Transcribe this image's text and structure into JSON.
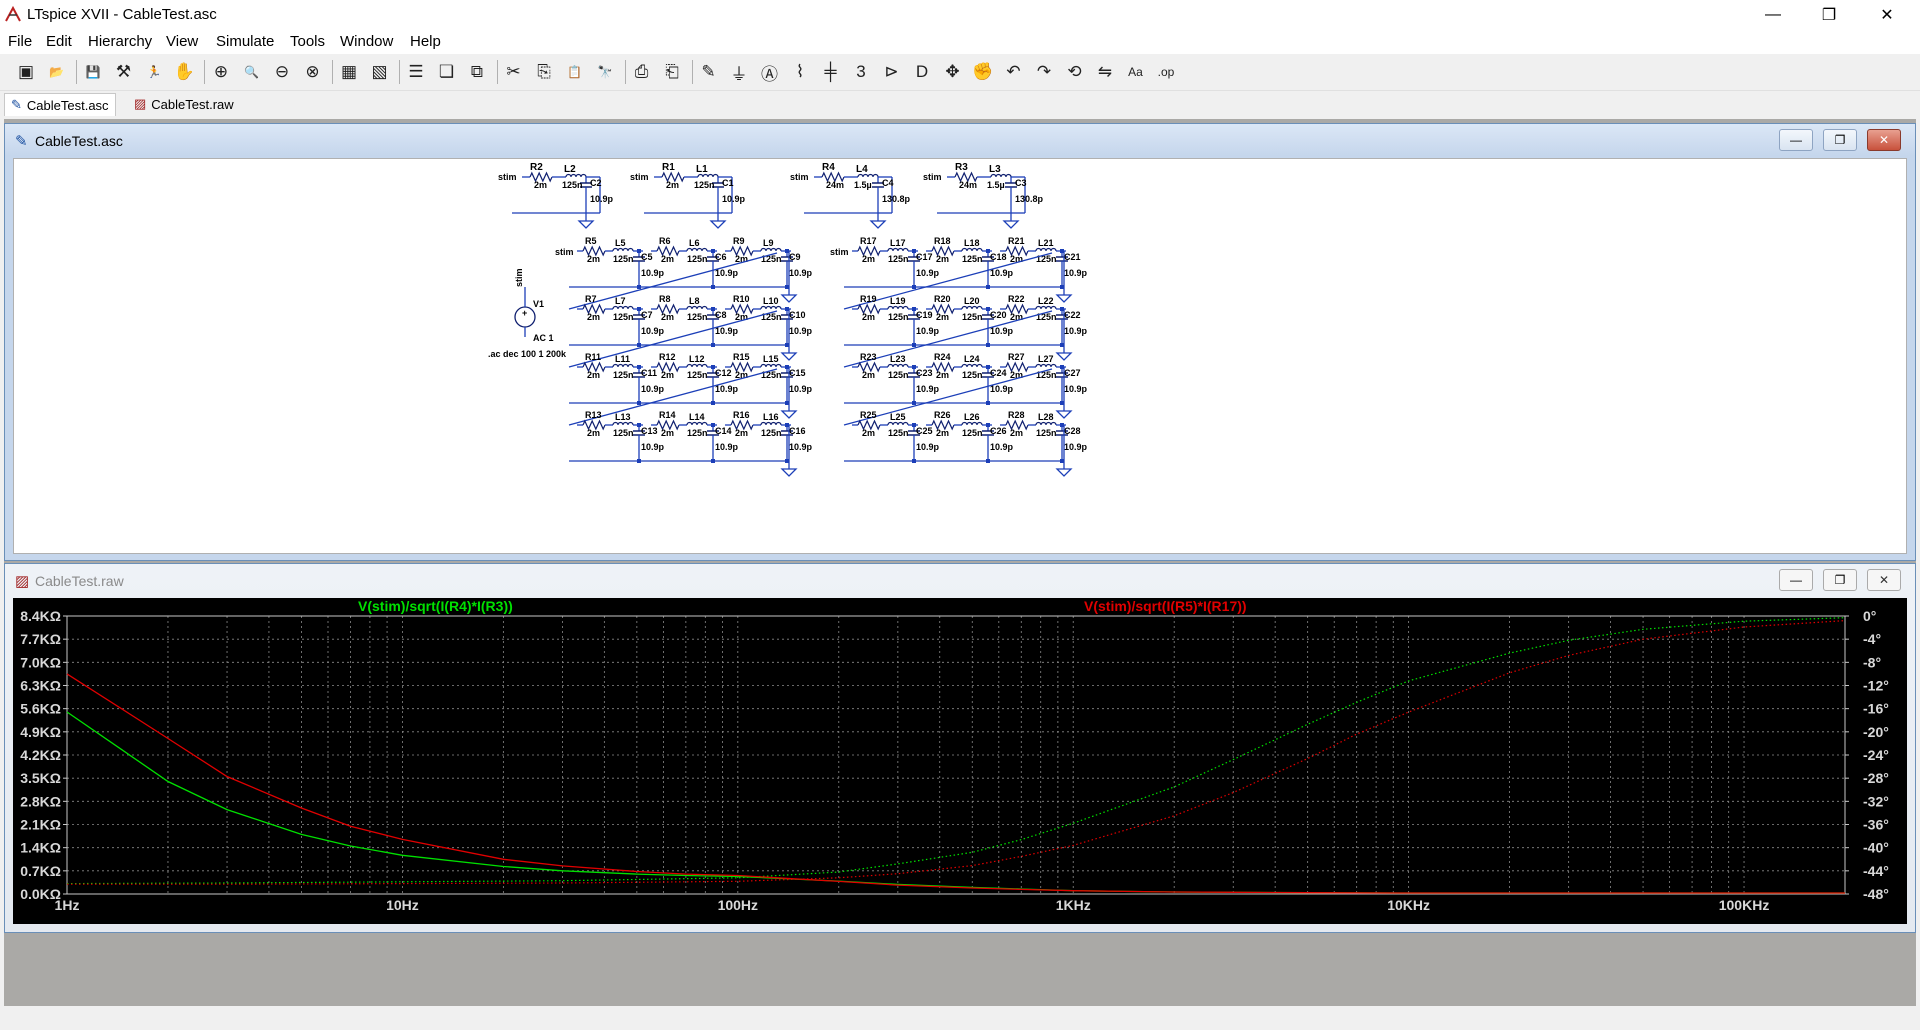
{
  "window": {
    "title": "LTspice XVII - CableTest.asc",
    "minimize": "—",
    "maximize": "❐",
    "close": "✕"
  },
  "menu": [
    {
      "label": "File",
      "name": "menu-file"
    },
    {
      "label": "Edit",
      "name": "menu-edit"
    },
    {
      "label": "Hierarchy",
      "name": "menu-hierarchy"
    },
    {
      "label": "View",
      "name": "menu-view"
    },
    {
      "label": "Simulate",
      "name": "menu-simulate"
    },
    {
      "label": "Tools",
      "name": "menu-tools"
    },
    {
      "label": "Window",
      "name": "menu-window"
    },
    {
      "label": "Help",
      "name": "menu-help"
    }
  ],
  "toolbar": [
    {
      "name": "new-schematic-icon",
      "glyph": "▣"
    },
    {
      "name": "open-folder-icon",
      "glyph": "📂"
    },
    {
      "sep": true
    },
    {
      "name": "save-icon",
      "glyph": "💾"
    },
    {
      "name": "control-panel-icon",
      "glyph": "⚒"
    },
    {
      "name": "run-icon",
      "glyph": "🏃"
    },
    {
      "name": "halt-icon",
      "glyph": "✋"
    },
    {
      "sep": true
    },
    {
      "name": "zoom-in-icon",
      "glyph": "⊕"
    },
    {
      "name": "pan-icon",
      "glyph": "🔍"
    },
    {
      "name": "zoom-out-icon",
      "glyph": "⊖"
    },
    {
      "name": "zoom-fit-icon",
      "glyph": "⊗"
    },
    {
      "sep": true
    },
    {
      "name": "autorange-icon",
      "glyph": "▦"
    },
    {
      "name": "plot-settings-icon",
      "glyph": "▧"
    },
    {
      "sep": true
    },
    {
      "name": "tile-horizontal-icon",
      "glyph": "☰"
    },
    {
      "name": "cascade-icon",
      "glyph": "❏"
    },
    {
      "name": "tile-vertical-icon",
      "glyph": "⧉"
    },
    {
      "sep": true
    },
    {
      "name": "cut-icon",
      "glyph": "✂"
    },
    {
      "name": "copy-icon",
      "glyph": "⎘"
    },
    {
      "name": "paste-icon",
      "glyph": "📋"
    },
    {
      "name": "find-icon",
      "glyph": "🔭"
    },
    {
      "sep": true
    },
    {
      "name": "print-icon",
      "glyph": "⎙"
    },
    {
      "name": "print-preview-icon",
      "glyph": "⎗"
    },
    {
      "sep": true
    },
    {
      "name": "draw-wire-icon",
      "glyph": "✎"
    },
    {
      "name": "ground-icon",
      "glyph": "⏚"
    },
    {
      "name": "label-net-icon",
      "glyph": "Ⓐ"
    },
    {
      "name": "resistor-icon",
      "glyph": "⌇"
    },
    {
      "name": "capacitor-icon",
      "glyph": "╪"
    },
    {
      "name": "inductor-icon",
      "glyph": "3"
    },
    {
      "name": "diode-icon",
      "glyph": "⊳"
    },
    {
      "name": "component-icon",
      "glyph": "D"
    },
    {
      "name": "move-icon",
      "glyph": "✥"
    },
    {
      "name": "drag-icon",
      "glyph": "✊"
    },
    {
      "name": "undo-icon",
      "glyph": "↶"
    },
    {
      "name": "redo-icon",
      "glyph": "↷"
    },
    {
      "name": "rotate-icon",
      "glyph": "⟲"
    },
    {
      "name": "mirror-icon",
      "glyph": "⇋"
    },
    {
      "name": "text-icon",
      "glyph": "Aa"
    },
    {
      "name": "spice-directive-icon",
      "glyph": ".op"
    }
  ],
  "tabs": [
    {
      "label": "CableTest.asc",
      "name": "tab-cabletest-asc",
      "active": true
    },
    {
      "label": "CableTest.raw",
      "name": "tab-cabletest-raw",
      "active": false
    }
  ],
  "schematic": {
    "title": "CableTest.asc",
    "top_cells": [
      {
        "stim": "stim",
        "r": "R2",
        "rv": "2m",
        "l": "L2",
        "lv": "125n",
        "c": "C2",
        "cv": "10.9p"
      },
      {
        "stim": "stim",
        "r": "R1",
        "rv": "2m",
        "l": "L1",
        "lv": "125n",
        "c": "C1",
        "cv": "10.9p"
      },
      {
        "stim": "stim",
        "r": "R4",
        "rv": "24m",
        "l": "L4",
        "lv": "1.5µ",
        "c": "C4",
        "cv": "130.8p"
      },
      {
        "stim": "stim",
        "r": "R3",
        "rv": "24m",
        "l": "L3",
        "lv": "1.5µ",
        "c": "C3",
        "cv": "130.8p"
      }
    ],
    "ladder_left": [
      [
        {
          "r": "R5",
          "l": "L5",
          "c": "C5"
        },
        {
          "r": "R6",
          "l": "L6",
          "c": "C6"
        },
        {
          "r": "R9",
          "l": "L9",
          "c": "C9"
        }
      ],
      [
        {
          "r": "R7",
          "l": "L7",
          "c": "C7"
        },
        {
          "r": "R8",
          "l": "L8",
          "c": "C8"
        },
        {
          "r": "R10",
          "l": "L10",
          "c": "C10"
        }
      ],
      [
        {
          "r": "R11",
          "l": "L11",
          "c": "C11"
        },
        {
          "r": "R12",
          "l": "L12",
          "c": "C12"
        },
        {
          "r": "R15",
          "l": "L15",
          "c": "C15"
        }
      ],
      [
        {
          "r": "R13",
          "l": "L13",
          "c": "C13"
        },
        {
          "r": "R14",
          "l": "L14",
          "c": "C14"
        },
        {
          "r": "R16",
          "l": "L16",
          "c": "C16"
        }
      ]
    ],
    "ladder_right": [
      [
        {
          "r": "R17",
          "l": "L17",
          "c": "C17"
        },
        {
          "r": "R18",
          "l": "L18",
          "c": "C18"
        },
        {
          "r": "R21",
          "l": "L21",
          "c": "C21"
        }
      ],
      [
        {
          "r": "R19",
          "l": "L19",
          "c": "C19"
        },
        {
          "r": "R20",
          "l": "L20",
          "c": "C20"
        },
        {
          "r": "R22",
          "l": "L22",
          "c": "C22"
        }
      ],
      [
        {
          "r": "R23",
          "l": "L23",
          "c": "C23"
        },
        {
          "r": "R24",
          "l": "L24",
          "c": "C24"
        },
        {
          "r": "R27",
          "l": "L27",
          "c": "C27"
        }
      ],
      [
        {
          "r": "R25",
          "l": "L25",
          "c": "C25"
        },
        {
          "r": "R26",
          "l": "L26",
          "c": "C26"
        },
        {
          "r": "R28",
          "l": "L28",
          "c": "C28"
        }
      ]
    ],
    "ladder_values": {
      "r": "2m",
      "l": "125n",
      "c": "10.9p"
    },
    "stim_label": "stim",
    "source": {
      "name": "V1",
      "net": "stim",
      "value": "AC 1"
    },
    "directive": ".ac dec 100 1 200k"
  },
  "plot_window": {
    "title": "CableTest.raw"
  },
  "chart_data": {
    "type": "line",
    "x_scale": "log",
    "xlim": [
      1,
      200000
    ],
    "x_ticks": [
      "1Hz",
      "10Hz",
      "100Hz",
      "1KHz",
      "10KHz",
      "100KHz"
    ],
    "x_tick_values": [
      1,
      10,
      100,
      1000,
      10000,
      100000
    ],
    "y_left_ticks": [
      "8.4KΩ",
      "7.7KΩ",
      "7.0KΩ",
      "6.3KΩ",
      "5.6KΩ",
      "4.9KΩ",
      "4.2KΩ",
      "3.5KΩ",
      "2.8KΩ",
      "2.1KΩ",
      "1.4KΩ",
      "0.7KΩ",
      "0.0KΩ"
    ],
    "y_left_values": [
      8.4,
      7.7,
      7.0,
      6.3,
      5.6,
      4.9,
      4.2,
      3.5,
      2.8,
      2.1,
      1.4,
      0.7,
      0.0
    ],
    "ylim_left": [
      0,
      8.4
    ],
    "y_left_unit": "KΩ",
    "y_right_ticks": [
      "0°",
      "-4°",
      "-8°",
      "-12°",
      "-16°",
      "-20°",
      "-24°",
      "-28°",
      "-32°",
      "-36°",
      "-40°",
      "-44°",
      "-48°"
    ],
    "ylim_right": [
      -48,
      0
    ],
    "grid": true,
    "background": "#000000",
    "series": [
      {
        "name": "V(stim)/sqrt(I(R4)*I(R3))",
        "color": "#00e000",
        "magnitude": {
          "x": [
            1,
            2,
            3,
            5,
            7,
            10,
            20,
            30,
            50,
            70,
            100,
            200,
            300,
            500,
            700,
            1000,
            2000,
            3000,
            5000,
            10000,
            20000,
            50000,
            100000,
            200000
          ],
          "y": [
            5.5,
            3.4,
            2.55,
            1.8,
            1.45,
            1.17,
            0.83,
            0.7,
            0.6,
            0.56,
            0.53,
            0.39,
            0.29,
            0.2,
            0.15,
            0.1,
            0.06,
            0.05,
            0.04,
            0.03,
            0.03,
            0.03,
            0.03,
            0.03
          ]
        },
        "phase": {
          "x": [
            1,
            3,
            10,
            30,
            100,
            200,
            300,
            500,
            700,
            1000,
            2000,
            3000,
            5000,
            7000,
            10000,
            20000,
            30000,
            50000,
            100000,
            200000
          ],
          "y": [
            -46.2,
            -46.1,
            -45.9,
            -45.7,
            -45.2,
            -44.2,
            -42.8,
            -40.8,
            -38.6,
            -35.8,
            -29.5,
            -24.8,
            -18.7,
            -14.9,
            -11.2,
            -6.4,
            -4.2,
            -2.3,
            -0.9,
            -0.3
          ]
        }
      },
      {
        "name": "V(stim)/sqrt(I(R5)*I(R17))",
        "color": "#e00000",
        "magnitude": {
          "x": [
            1,
            2,
            3,
            5,
            7,
            10,
            20,
            30,
            50,
            70,
            100,
            200,
            300,
            500,
            700,
            1000,
            2000,
            3000,
            5000,
            10000,
            20000,
            50000,
            100000,
            200000
          ],
          "y": [
            6.65,
            4.7,
            3.55,
            2.6,
            2.05,
            1.65,
            1.05,
            0.85,
            0.68,
            0.6,
            0.56,
            0.38,
            0.27,
            0.18,
            0.14,
            0.1,
            0.06,
            0.05,
            0.04,
            0.03,
            0.03,
            0.03,
            0.03,
            0.03
          ]
        },
        "phase": {
          "x": [
            1,
            3,
            10,
            30,
            100,
            200,
            300,
            500,
            700,
            1000,
            2000,
            3000,
            5000,
            7000,
            10000,
            20000,
            30000,
            50000,
            100000,
            200000
          ],
          "y": [
            -46.3,
            -46.3,
            -46.2,
            -46.1,
            -45.8,
            -45.2,
            -44.5,
            -43.1,
            -41.5,
            -39.6,
            -34.5,
            -30.5,
            -24.6,
            -20.4,
            -16.6,
            -9.8,
            -6.8,
            -4.0,
            -1.9,
            -0.8
          ]
        }
      }
    ]
  }
}
